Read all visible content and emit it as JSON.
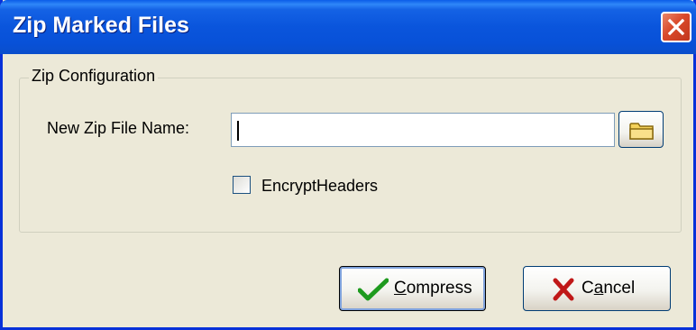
{
  "window": {
    "title": "Zip Marked Files"
  },
  "group": {
    "legend": "Zip Configuration"
  },
  "form": {
    "filename_label": "New Zip File Name:",
    "filename_value": "",
    "encrypt_label": "EncryptHeaders",
    "encrypt_checked": false
  },
  "buttons": {
    "compress_first": "C",
    "compress_rest": "ompress",
    "cancel_first": "C",
    "cancel_underlined": "a",
    "cancel_rest": "ncel"
  },
  "colors": {
    "titlebar": "#0a55dc",
    "window_bg": "#ece9d8",
    "close_red": "#d9492a",
    "check_green": "#1e9a1e",
    "cancel_red": "#c01818"
  },
  "icons": {
    "close": "close-icon",
    "browse": "folder-icon",
    "compress": "checkmark-icon",
    "cancel": "x-icon"
  }
}
